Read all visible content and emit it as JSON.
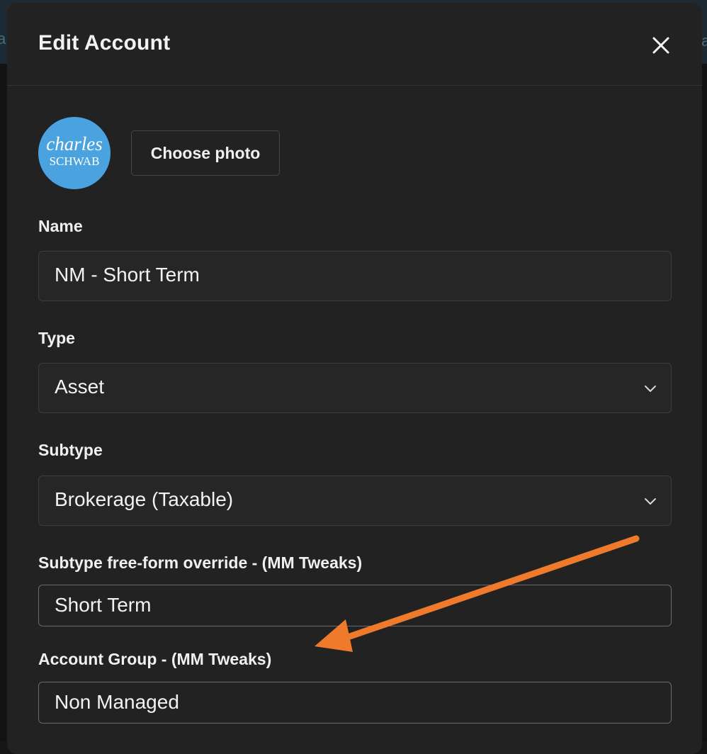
{
  "modal": {
    "title": "Edit Account"
  },
  "photo": {
    "avatar_line1": "charles",
    "avatar_line2": "SCHWAB",
    "choose_label": "Choose photo"
  },
  "fields": {
    "name": {
      "label": "Name",
      "value": "NM - Short Term"
    },
    "type": {
      "label": "Type",
      "value": "Asset"
    },
    "subtype": {
      "label": "Subtype",
      "value": "Brokerage (Taxable)"
    },
    "subtype_override": {
      "label": "Subtype free-form override - (MM Tweaks)",
      "value": "Short Term"
    },
    "account_group": {
      "label": "Account Group - (MM Tweaks)",
      "value": "Non Managed"
    }
  },
  "colors": {
    "avatar_bg": "#4aa3df",
    "annotation_arrow": "#f07a2c"
  },
  "icons": {
    "close": "close-icon",
    "dropdown": "chevron-down-icon",
    "annotation": "arrow-annotation-icon"
  }
}
